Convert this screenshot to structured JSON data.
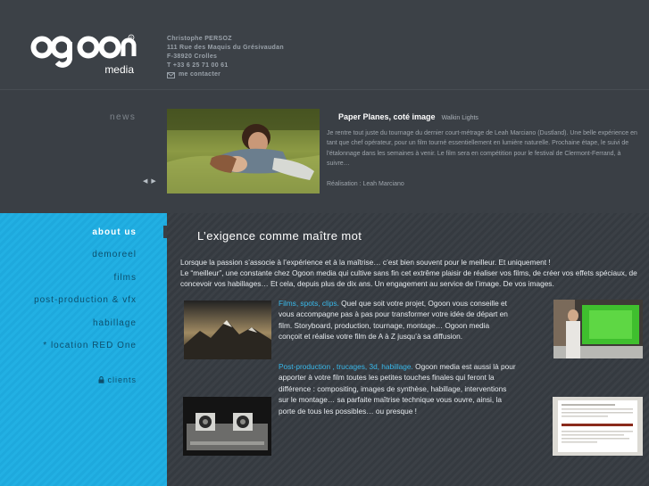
{
  "header": {
    "logo": {
      "word": "ogoon",
      "sub": "media",
      "trademark": "®"
    },
    "contact": {
      "name": "Christophe PERSOZ",
      "street": "111 Rue des Maquis du Grésivaudan",
      "city": "F-38920 Crolles",
      "phone": "T +33 6 25 71 00 61",
      "mail_label": "me contacter",
      "mail_icon": "envelope-icon"
    }
  },
  "news": {
    "label": "news",
    "prev_arrow": "◀",
    "next_arrow": "▶",
    "title": "Paper Planes, coté image",
    "subtitle": "Walkin Lights",
    "text": "Je rentre tout juste du tournage du dernier court-métrage de Leah Marciano (Dustland). Une belle expérience en tant que chef opérateur, pour un film tourné essentiellement en lumière naturelle. Prochaine étape, le suivi de l'étalonnage dans les semaines à venir. Le film sera en compétition pour le festival de Clermont-Ferrand, à suivre…",
    "credit": "Réalisation : Leah Marciano"
  },
  "nav": {
    "items": [
      {
        "label": "about us",
        "active": true
      },
      {
        "label": "demoreel",
        "active": false
      },
      {
        "label": "films",
        "active": false
      },
      {
        "label": "post-production & vfx",
        "active": false
      },
      {
        "label": "habillage",
        "active": false
      },
      {
        "label": "* location RED One",
        "active": false
      }
    ],
    "clients": "clients",
    "clients_icon": "lock-icon"
  },
  "main": {
    "title": "L’exigence comme maître mot",
    "intro_1": "Lorsque la passion s’associe à l’expérience et à la maîtrise… c’est bien souvent pour le meilleur. Et uniquement !",
    "intro_2": "Le “meilleur”, une constante chez Ogoon media qui cultive sans fin cet extrême plaisir de réaliser vos films, de créer vos effets spéciaux, de concevoir vos habillages… Et cela, depuis plus de dix ans. Un engagement au service de l’image. De vos images.",
    "block1": {
      "highlight": "Films, spots, clips.",
      "text": " Quel que soit votre projet, Ogoon vous conseille et vous accompagne pas à pas pour transformer votre idée de départ en film. Storyboard, production, tournage, montage… Ogoon media conçoit et réalise votre film de A à Z jusqu’à sa diffusion."
    },
    "block2": {
      "highlight": "Post-production , trucages, 3d, habillage.",
      "text": " Ogoon media est aussi là pour apporter à votre film toutes les petites touches finales qui feront la différence : compositing, images de synthèse, habillage, interventions sur le montage… sa parfaite maîtrise technique vous ouvre, ainsi, la porte de tous les possibles… ou presque !"
    }
  },
  "colors": {
    "accent": "#1ea9dd",
    "highlight": "#38b8ea",
    "nav_text": "#0d4f6d",
    "background": "#3a3f45"
  }
}
